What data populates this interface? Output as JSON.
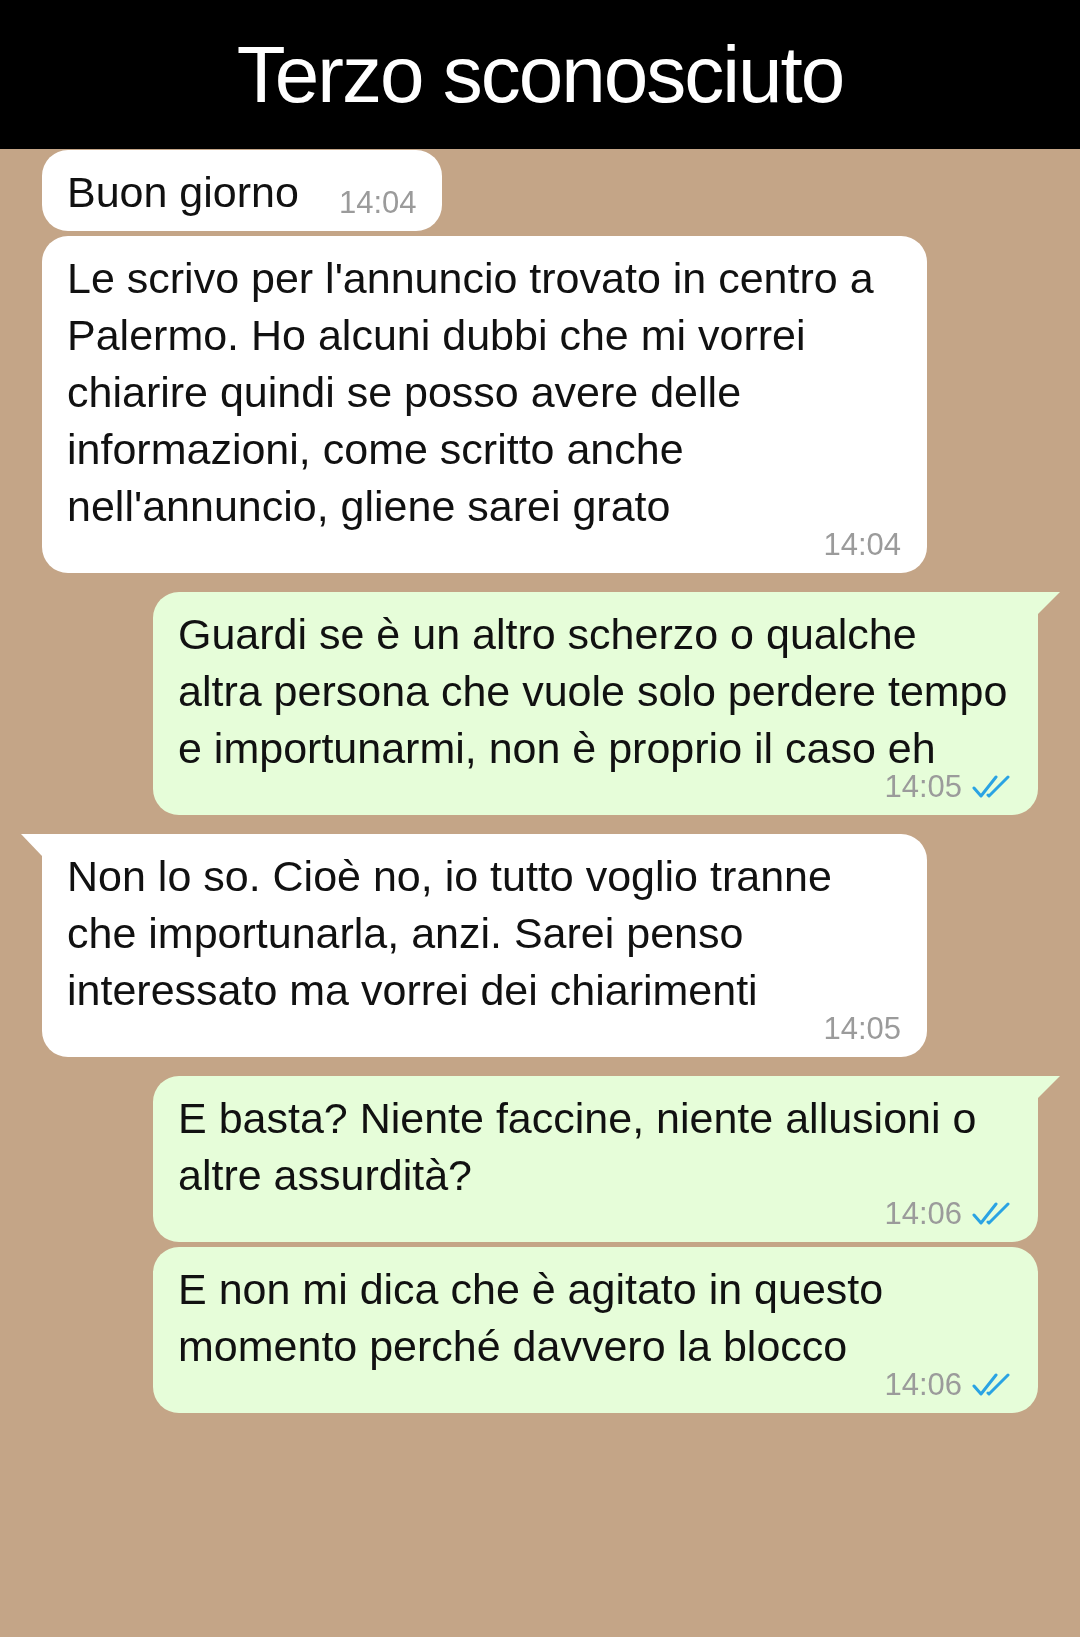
{
  "header": {
    "title": "Terzo sconosciuto"
  },
  "messages": [
    {
      "outgoing": false,
      "text": "Buon giorno",
      "time": "14:04",
      "tail": false
    },
    {
      "outgoing": false,
      "text": "Le scrivo per l'annuncio trovato in centro a Palermo. Ho alcuni dubbi che mi vorrei chiarire quindi se posso avere delle informazioni, come scritto anche nell'annuncio, gliene sarei grato",
      "time": "14:04",
      "tail": false
    },
    {
      "outgoing": true,
      "text": "Guardi se è un altro scherzo o qualche altra persona che vuole solo perdere tempo e importunarmi, non è proprio il caso eh",
      "time": "14:05",
      "tail": true,
      "read": true
    },
    {
      "outgoing": false,
      "text": "Non lo so. Cioè no, io tutto voglio tranne che importunarla, anzi. Sarei penso interessato ma vorrei dei chiarimenti",
      "time": "14:05",
      "tail": true
    },
    {
      "outgoing": true,
      "text": "E basta? Niente faccine, niente allusioni o altre assurdità?",
      "time": "14:06",
      "tail": true,
      "read": true
    },
    {
      "outgoing": true,
      "text": "E non mi dica che è agitato in questo momento perché davvero la blocco",
      "time": "14:06",
      "tail": false,
      "read": true
    }
  ]
}
